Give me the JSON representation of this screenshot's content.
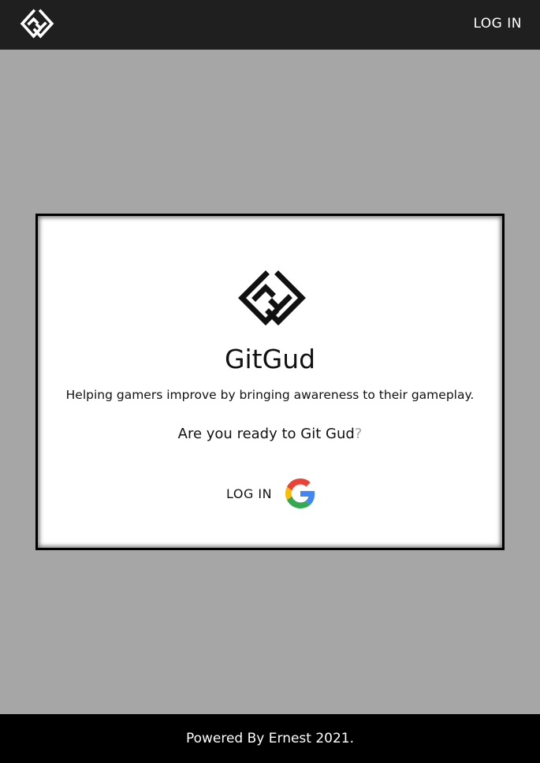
{
  "header": {
    "login_label": "LOG IN",
    "logo_icon": "gitgud-logo-icon"
  },
  "card": {
    "logo_icon": "gitgud-logo-icon",
    "title": "GitGud",
    "tagline": "Helping gamers improve by bringing awareness to their gameplay.",
    "question_main": "Are you ready to Git Gud",
    "question_mark": "?",
    "google_login": {
      "label": "LOG IN",
      "icon": "google-icon"
    }
  },
  "footer": {
    "text": "Powered By Ernest 2021."
  },
  "colors": {
    "topbar": "#1f1f1f",
    "page_background": "#a6a6a6",
    "card_background": "#ffffff",
    "footer": "#000000"
  }
}
